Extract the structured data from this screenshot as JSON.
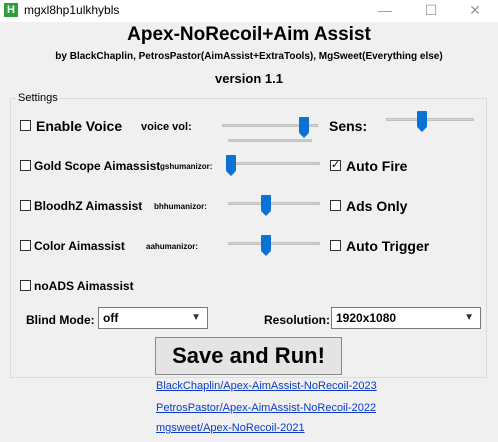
{
  "window": {
    "title": "mgxl8hp1ulkhybls",
    "icon_letter": "H",
    "minimize_icon": "—",
    "maximize_icon": "☐",
    "close_icon": "✕"
  },
  "header": {
    "title": "Apex-NoRecoil+Aim Assist",
    "credits": "by BlackChaplin, PetrosPastor(AimAssist+ExtraTools), MgSweet(Everything else)",
    "version": "version 1.1"
  },
  "settings": {
    "group_label": "Settings",
    "enable_voice": {
      "label": "Enable Voice",
      "checked": false
    },
    "voice_vol": {
      "label": "voice vol:",
      "value": 0.9
    },
    "sens": {
      "label": "Sens:",
      "value": 0.4
    },
    "gold_scope": {
      "label": "Gold Scope Aimassist",
      "checked": false
    },
    "gshumanizor": {
      "label": "gshumanizor:",
      "value": 0.0
    },
    "auto_fire": {
      "label": "Auto Fire",
      "checked": true,
      "mark": "✓"
    },
    "bloodhz": {
      "label": "BloodhZ Aimassist",
      "checked": false
    },
    "bhhumanizor": {
      "label": "bhhumanizor:",
      "value": 0.4
    },
    "ads_only": {
      "label": "Ads Only",
      "checked": false
    },
    "color": {
      "label": "Color Aimassist",
      "checked": false
    },
    "aahumanizor": {
      "label": "aahumanizor:",
      "value": 0.4
    },
    "auto_trigger": {
      "label": "Auto Trigger",
      "checked": false
    },
    "noads": {
      "label": "noADS Aimassist",
      "checked": false
    },
    "blind_mode": {
      "label": "Blind Mode:",
      "value": "off"
    },
    "resolution": {
      "label": "Resolution:",
      "value": "1920x1080"
    },
    "dropdown_icon": "▼"
  },
  "run_button": "Save and Run!",
  "links": [
    "BlackChaplin/Apex-AimAssist-NoRecoil-2023",
    "PetrosPastor/Apex-AimAssist-NoRecoil-2022",
    "mgsweet/Apex-NoRecoil-2021"
  ]
}
